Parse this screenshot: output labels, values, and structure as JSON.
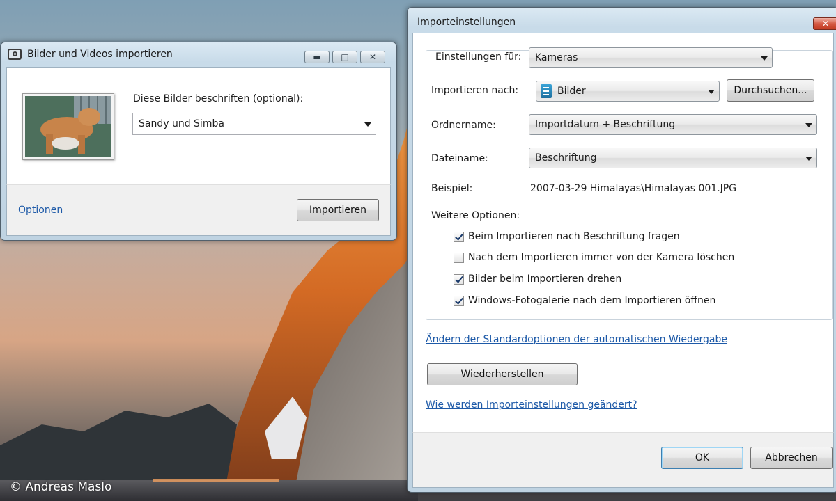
{
  "import_window": {
    "title": "Bilder und Videos importieren",
    "caption_label": "Diese Bilder beschriften (optional):",
    "caption_value": "Sandy und Simba",
    "options_link": "Optionen",
    "import_button": "Importieren"
  },
  "settings_window": {
    "title": "Importeinstellungen",
    "settings_for_label": "Einstellungen für:",
    "settings_for_value": "Kameras",
    "import_to_label": "Importieren nach:",
    "import_to_value": "Bilder",
    "browse_button": "Durchsuchen...",
    "folder_name_label": "Ordnername:",
    "folder_name_value": "Importdatum + Beschriftung",
    "file_name_label": "Dateiname:",
    "file_name_value": "Beschriftung",
    "example_label": "Beispiel:",
    "example_value": "2007-03-29 Himalayas\\Himalayas 001.JPG",
    "more_options_label": "Weitere Optionen:",
    "options": [
      {
        "label": "Beim Importieren nach Beschriftung fragen",
        "checked": true
      },
      {
        "label": "Nach dem Importieren immer von der Kamera löschen",
        "checked": false
      },
      {
        "label": "Bilder beim Importieren drehen",
        "checked": true
      },
      {
        "label": "Windows-Fotogalerie nach dem Importieren öffnen",
        "checked": true
      }
    ],
    "autoplay_link": "Ändern der Standardoptionen der automatischen Wiedergabe",
    "restore_button": "Wiederherstellen",
    "help_link": "Wie werden Importeinstellungen geändert?",
    "ok_button": "OK",
    "cancel_button": "Abbrechen"
  },
  "copyright": "© Andreas Maslo"
}
